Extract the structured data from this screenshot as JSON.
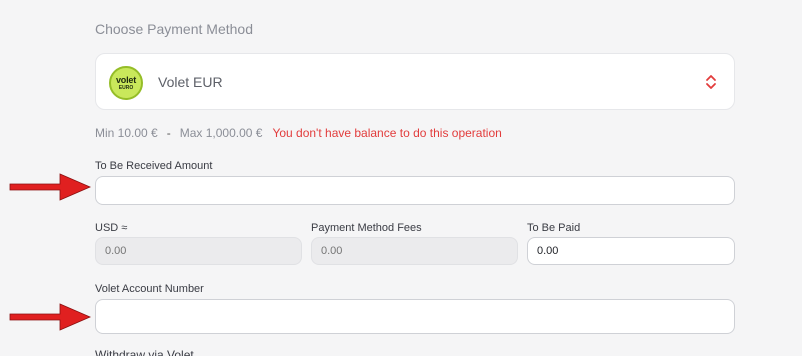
{
  "section_title": "Choose Payment Method",
  "method": {
    "logo_line1": "volet",
    "logo_line2": "EURO",
    "name": "Volet EUR",
    "icon": "chevron-up-down-icon"
  },
  "limits": {
    "min": "Min 10.00 €",
    "separator": "-",
    "max": "Max 1,000.00 €",
    "error": "You don't have balance to do this operation",
    "error_color": "#e23c3c"
  },
  "fields": {
    "received": {
      "label": "To Be Received Amount",
      "value": ""
    },
    "usd": {
      "label": "USD ≈",
      "placeholder": "0.00"
    },
    "fees": {
      "label": "Payment Method Fees",
      "placeholder": "0.00"
    },
    "paid": {
      "label": "To Be Paid",
      "value": "0.00"
    },
    "account": {
      "label": "Volet Account Number",
      "value": ""
    }
  },
  "footer_label": "Withdraw via Volet",
  "annotations": {
    "arrow_color": "#e02020",
    "icon": "red-arrow-icon"
  }
}
